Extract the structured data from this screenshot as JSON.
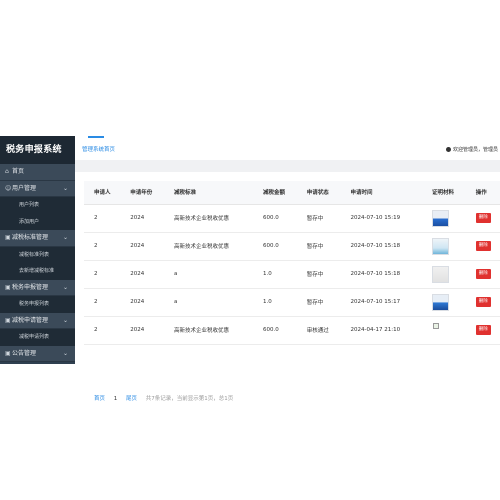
{
  "sidebar": {
    "brand": "税务申报系统",
    "menu": [
      {
        "label": "首页",
        "icon": "home-icon",
        "glyph": "⌂",
        "chevron": false,
        "children": []
      },
      {
        "label": "用户管理",
        "icon": "user-icon",
        "glyph": "☺",
        "chevron": true,
        "children": [
          "用户列表",
          "添加用户"
        ]
      },
      {
        "label": "减税标准管理",
        "icon": "document-icon",
        "glyph": "▣",
        "chevron": true,
        "children": [
          "减税标准列表",
          "去新增减税标准"
        ]
      },
      {
        "label": "税务申报管理",
        "icon": "document-icon",
        "glyph": "▣",
        "chevron": true,
        "children": [
          "税务申报列表"
        ]
      },
      {
        "label": "减税申请管理",
        "icon": "document-icon",
        "glyph": "▣",
        "chevron": true,
        "children": [
          "减税申请列表"
        ]
      },
      {
        "label": "公告管理",
        "icon": "document-icon",
        "glyph": "▣",
        "chevron": true,
        "children": []
      }
    ]
  },
  "header": {
    "breadcrumb": "管理系统首页",
    "welcome": "欢迎管理员，管理员"
  },
  "table": {
    "columns": [
      "申请人",
      "申请年份",
      "减税标准",
      "减税金额",
      "申请状态",
      "申请时间",
      "证明材料",
      "操作"
    ],
    "rows": [
      {
        "applicant": "2",
        "year": "2024",
        "standard": "高新技术企业税收优惠",
        "amount": "600.0",
        "status": "暂存中",
        "time": "2024-07-10 15:19",
        "proof": "t1",
        "action": "删除"
      },
      {
        "applicant": "2",
        "year": "2024",
        "standard": "高新技术企业税收优惠",
        "amount": "600.0",
        "status": "暂存中",
        "time": "2024-07-10 15:18",
        "proof": "t2",
        "action": "删除"
      },
      {
        "applicant": "2",
        "year": "2024",
        "standard": "a",
        "amount": "1.0",
        "status": "暂存中",
        "time": "2024-07-10 15:18",
        "proof": "t3",
        "action": "删除"
      },
      {
        "applicant": "2",
        "year": "2024",
        "standard": "a",
        "amount": "1.0",
        "status": "暂存中",
        "time": "2024-07-10 15:17",
        "proof": "t4",
        "action": "删除"
      },
      {
        "applicant": "2",
        "year": "2024",
        "standard": "高新技术企业税收优惠",
        "amount": "600.0",
        "status": "审核通过",
        "time": "2024-04-17 21:10",
        "proof": "t5",
        "action": "删除"
      }
    ]
  },
  "pager": {
    "first": "首页",
    "current": "1",
    "last": "尾页",
    "summary": "共7条记录，当前显示第1页，总1页"
  },
  "colors": {
    "sidebar_bg": "#2f4050",
    "accent": "#2a8be4",
    "danger": "#e0312f"
  }
}
